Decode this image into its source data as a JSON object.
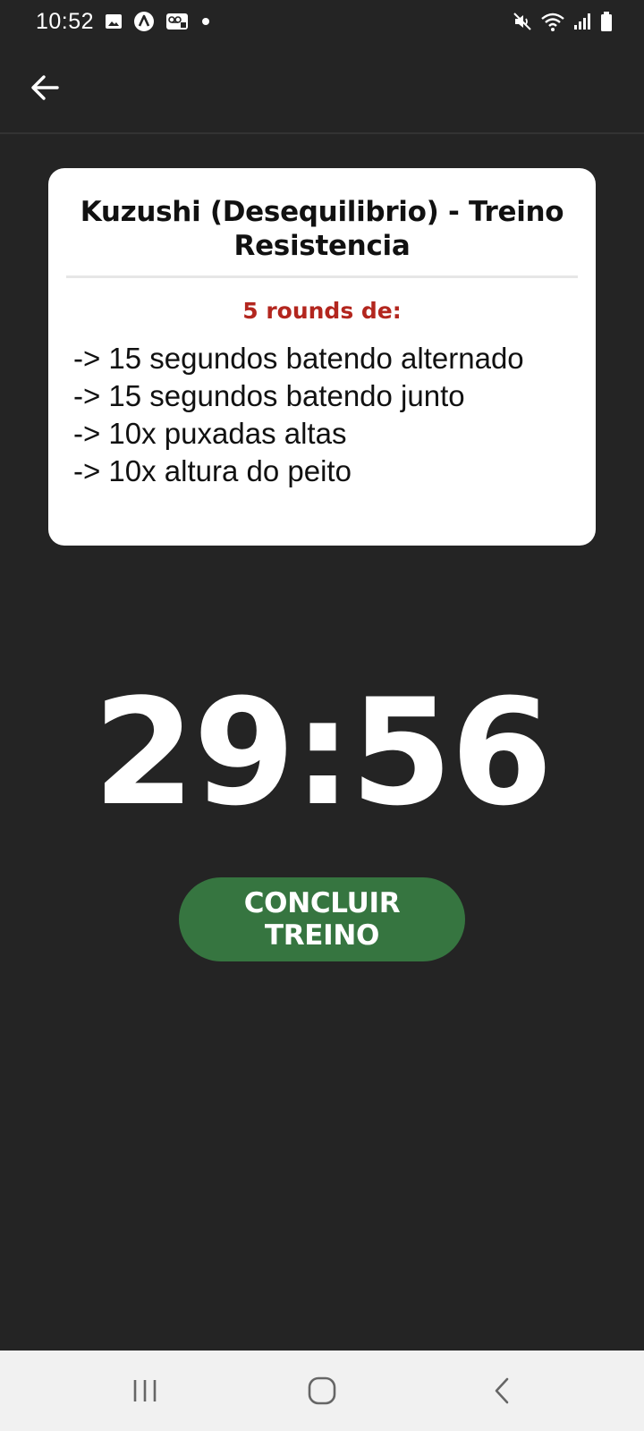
{
  "status_bar": {
    "time": "10:52",
    "icons": [
      "image-icon",
      "app-logo-icon",
      "voicemail-icon",
      "notification-dot-icon",
      "mute-icon",
      "wifi-icon",
      "signal-icon",
      "battery-icon"
    ]
  },
  "app_bar": {
    "back_icon": "arrow-left-icon"
  },
  "workout": {
    "title": "Kuzushi (Desequilibrio) - Treino Resistencia",
    "rounds_label": "5 rounds de:",
    "exercises": [
      "-> 15 segundos batendo alternado",
      "-> 15 segundos batendo junto",
      "-> 10x puxadas altas",
      "-> 10x altura do peito"
    ]
  },
  "timer": {
    "value": "29:56"
  },
  "actions": {
    "finish_label": "CONCLUIR TREINO"
  },
  "colors": {
    "background": "#242424",
    "card": "#ffffff",
    "rounds_accent": "#b3261e",
    "finish_button": "#367540",
    "nav_bar": "#f1f1f1"
  },
  "nav_bar": {
    "icons": [
      "recent-apps-icon",
      "home-icon",
      "back-icon"
    ]
  }
}
